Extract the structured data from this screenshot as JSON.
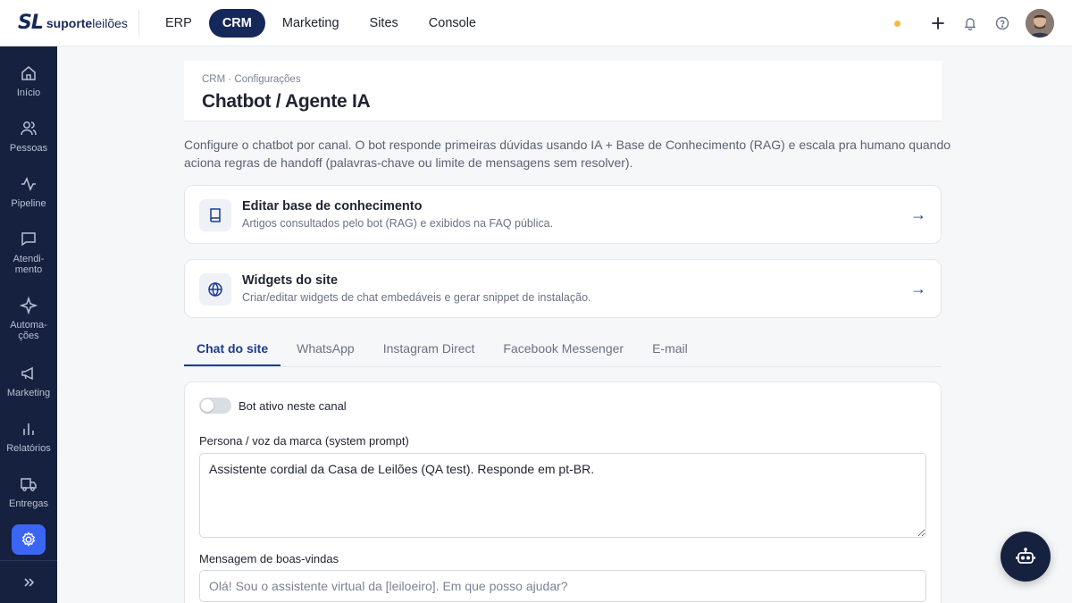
{
  "brand": {
    "mark": "SL",
    "name_bold": "suporte",
    "name_rest": "leilões"
  },
  "nav": {
    "items": [
      {
        "label": "ERP"
      },
      {
        "label": "CRM",
        "active": true
      },
      {
        "label": "Marketing"
      },
      {
        "label": "Sites"
      },
      {
        "label": "Console"
      }
    ]
  },
  "topbar": {
    "icons": [
      "status-dot",
      "plus-icon",
      "bell-icon",
      "help-icon",
      "avatar"
    ]
  },
  "sidebar": {
    "items": [
      {
        "label": "Início",
        "icon": "home-icon"
      },
      {
        "label": "Pessoas",
        "icon": "users-icon"
      },
      {
        "label": "Pipeline",
        "icon": "activity-icon"
      },
      {
        "label": "Atendi-\nmento",
        "icon": "chat-icon"
      },
      {
        "label": "Automa-\nções",
        "icon": "sparkle-icon"
      },
      {
        "label": "Marketing",
        "icon": "megaphone-icon"
      },
      {
        "label": "Relatórios",
        "icon": "bar-chart-icon"
      },
      {
        "label": "Entregas",
        "icon": "truck-icon"
      },
      {
        "label": "",
        "icon": "gear-icon",
        "active": true
      }
    ],
    "collapse_icon": "double-chevron-right-icon"
  },
  "header": {
    "breadcrumb": "CRM · Configurações",
    "title": "Chatbot / Agente IA"
  },
  "description": "Configure o chatbot por canal. O bot responde primeiras dúvidas usando IA + Base de Conhecimento (RAG) e escala pra humano quando aciona regras de handoff (palavras-chave ou limite de mensagens sem resolver).",
  "cards": [
    {
      "title": "Editar base de conhecimento",
      "subtitle": "Artigos consultados pelo bot (RAG) e exibidos na FAQ pública.",
      "icon": "book-icon",
      "arrow": "→"
    },
    {
      "title": "Widgets do site",
      "subtitle": "Criar/editar widgets de chat embedáveis e gerar snippet de instalação.",
      "icon": "globe-icon",
      "arrow": "→"
    }
  ],
  "tabs": [
    {
      "label": "Chat do site",
      "active": true
    },
    {
      "label": "WhatsApp"
    },
    {
      "label": "Instagram Direct"
    },
    {
      "label": "Facebook Messenger"
    },
    {
      "label": "E-mail"
    }
  ],
  "form": {
    "toggle_label": "Bot ativo neste canal",
    "toggle_on": false,
    "persona_label": "Persona / voz da marca (system prompt)",
    "persona_value": "Assistente cordial da Casa de Leilões (QA test). Responde em pt-BR.",
    "welcome_label": "Mensagem de boas-vindas",
    "welcome_placeholder": "Olá! Sou o assistente virtual da [leiloeiro]. Em que posso ajudar?"
  },
  "fab": {
    "icon": "robot-icon"
  },
  "colors": {
    "navy": "#16213f",
    "accent": "#1d3a8f",
    "active_blue": "#3b66f5",
    "status_dot": "#f5b942"
  }
}
